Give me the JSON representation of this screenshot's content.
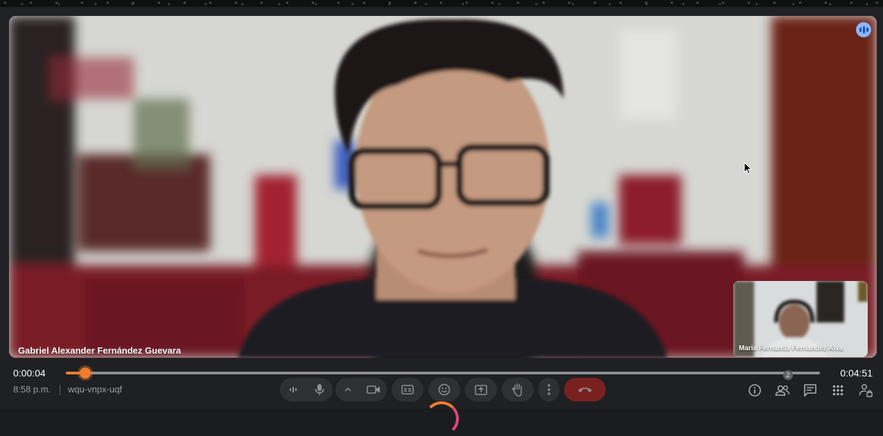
{
  "main_video": {
    "participant_name": "Gabriel Alexander Fernández Guevara"
  },
  "pip_video": {
    "participant_name": "Maria Fernanda Fernandez Alva"
  },
  "player": {
    "current_time": "0:00:04",
    "total_time": "0:04:51",
    "progress": 0.014
  },
  "meeting": {
    "clock": "8:58 p.m.",
    "code": "wqu-vnpx-uqf",
    "people_count": "2"
  },
  "icons": {
    "speaking": "audio-bars-icon",
    "mic": "microphone-icon",
    "camera": "camera-icon",
    "captions": "captions-icon",
    "emoji": "emoji-icon",
    "present": "present-screen-icon",
    "hand": "raise-hand-icon",
    "more": "more-vert-icon",
    "end_call": "end-call-icon",
    "info": "info-icon",
    "people": "people-icon",
    "chat": "chat-icon",
    "activities": "apps-grid-icon",
    "host_controls": "lock-person-icon"
  },
  "colors": {
    "accent": "#f17c30",
    "end_call": "#c5221f",
    "speaking": "#8ab4f8"
  }
}
